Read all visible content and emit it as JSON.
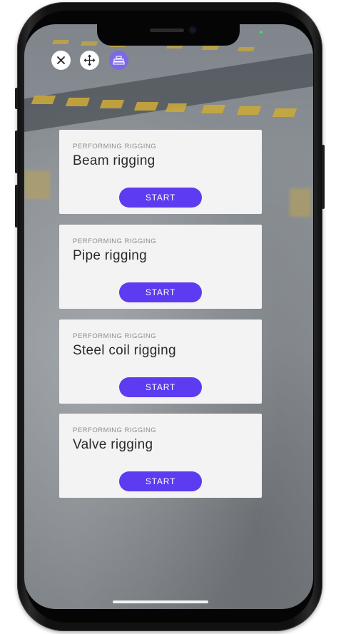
{
  "toolbar": {
    "close_icon": "close-icon",
    "move_icon": "move-arrows-icon",
    "layers_icon": "layers-icon",
    "accent_color": "#7b69e8"
  },
  "cards": [
    {
      "subtitle": "PERFORMING RIGGING",
      "title": "Beam rigging",
      "button": "START"
    },
    {
      "subtitle": "PERFORMING RIGGING",
      "title": "Pipe rigging",
      "button": "START"
    },
    {
      "subtitle": "PERFORMING RIGGING",
      "title": "Steel coil rigging",
      "button": "START"
    },
    {
      "subtitle": "PERFORMING RIGGING",
      "title": "Valve rigging",
      "button": "START"
    }
  ],
  "button_color": "#5d3bf0"
}
